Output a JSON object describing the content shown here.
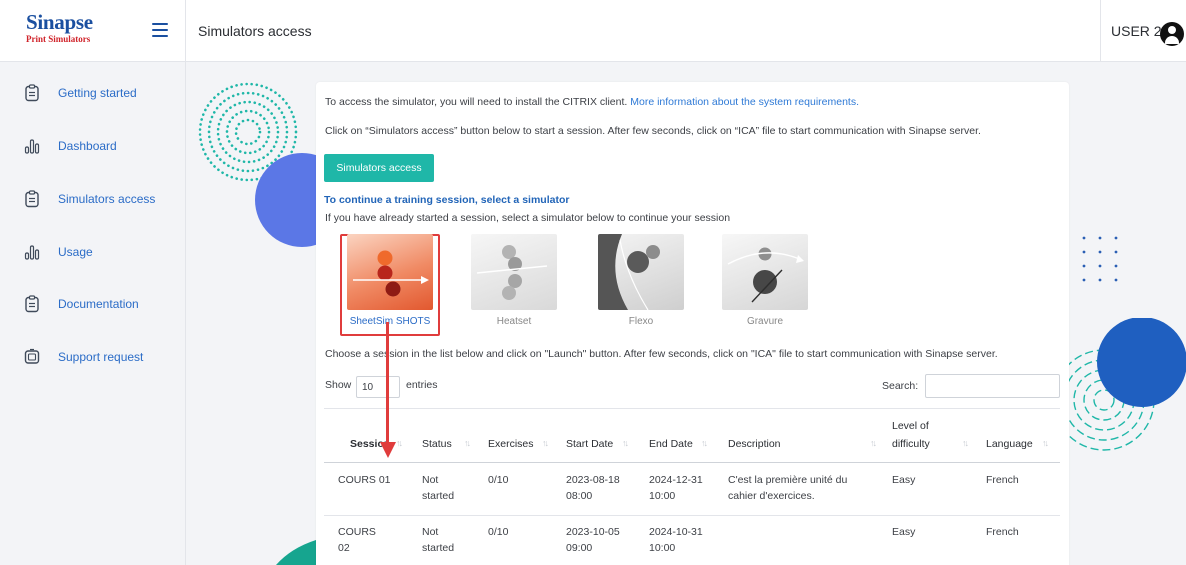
{
  "brand": {
    "name": "Sinapse",
    "subtitle": "Print Simulators"
  },
  "header": {
    "title": "Simulators access",
    "user": "USER 2"
  },
  "sidebar": {
    "items": [
      {
        "label": "Getting started",
        "icon": "clipboard-icon"
      },
      {
        "label": "Dashboard",
        "icon": "bar-chart-icon"
      },
      {
        "label": "Simulators access",
        "icon": "clipboard-icon"
      },
      {
        "label": "Usage",
        "icon": "bar-chart-icon"
      },
      {
        "label": "Documentation",
        "icon": "clipboard-icon"
      },
      {
        "label": "Support request",
        "icon": "monitor-icon"
      }
    ]
  },
  "main": {
    "intro_text": "To access the simulator, you will need to install the CITRIX client.",
    "intro_link": "More information about the system requirements.",
    "instructions": "Click on “Simulators access” button below to start a session. After few seconds, click on “ICA” file to start communication with Sinapse server.",
    "access_button": "Simulators access",
    "continue_title": "To continue a training session, select a simulator",
    "continue_text": "If you have already started a session, select a simulator below to continue your session",
    "simulators": [
      {
        "label": "SheetSim SHOTS",
        "selected": true
      },
      {
        "label": "Heatset",
        "selected": false
      },
      {
        "label": "Flexo",
        "selected": false
      },
      {
        "label": "Gravure",
        "selected": false
      }
    ],
    "session_instructions": "Choose a session in the list below and click on \"Launch\" button. After few seconds, click on \"ICA\" file to start communication with Sinapse server.",
    "show_label": "Show",
    "entries_value": "10",
    "entries_label": "entries",
    "search_label": "Search:",
    "search_value": "",
    "table": {
      "columns": [
        "Session",
        "Status",
        "Exercises",
        "Start Date",
        "End Date",
        "Description",
        "Level of difficulty",
        "Language"
      ],
      "level_line1": "Level of",
      "level_line2": "difficulty",
      "rows": [
        {
          "session": [
            "COURS 01"
          ],
          "status": [
            "Not",
            "started"
          ],
          "exercises": "0/10",
          "start": [
            "2023-08-18",
            "08:00"
          ],
          "end": [
            "2024-12-31",
            "10:00"
          ],
          "description": [
            "C'est la première unité du",
            "cahier d'exercices."
          ],
          "difficulty": "Easy",
          "language": "French"
        },
        {
          "session": [
            "COURS",
            "02"
          ],
          "status": [
            "Not",
            "started"
          ],
          "exercises": "0/10",
          "start": [
            "2023-10-05",
            "09:00"
          ],
          "end": [
            "2024-10-31",
            "10:00"
          ],
          "description": [
            "",
            ""
          ],
          "difficulty": "Easy",
          "language": "French"
        }
      ]
    }
  },
  "colors": {
    "brand_blue": "#1a4fa0",
    "brand_red": "#d0232a",
    "accent_teal": "#1fb7a8",
    "link_blue": "#2f7ad6",
    "highlight_red": "#e03c3c"
  }
}
